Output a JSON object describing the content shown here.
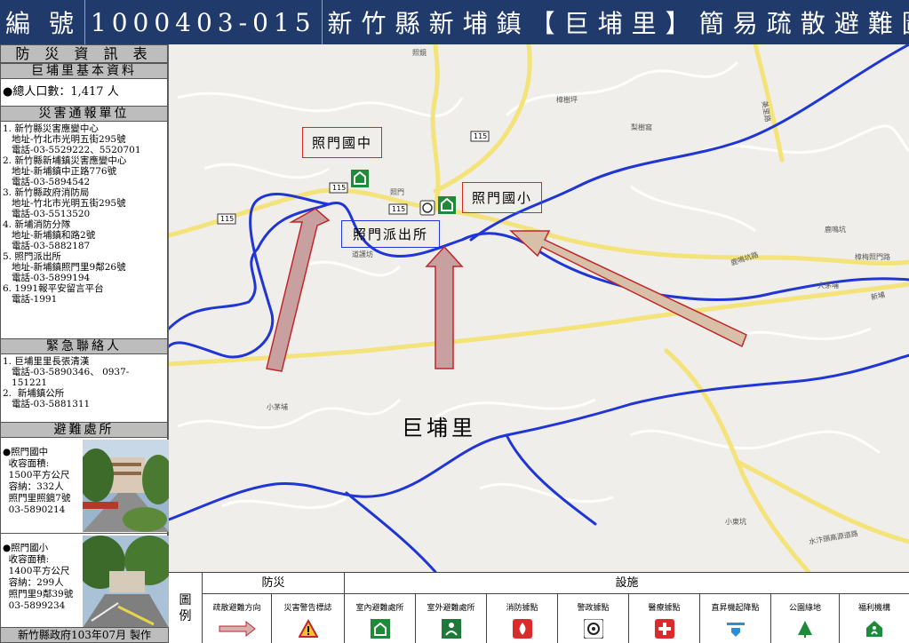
{
  "title": {
    "prefix": "編 號",
    "code": "1000403-015",
    "name": [
      "新",
      "竹",
      "縣",
      "新",
      "埔",
      "鎮",
      "【",
      "巨",
      "埔",
      "里",
      "】",
      "簡",
      "易",
      "疏",
      "散",
      "避",
      "難",
      "圖"
    ]
  },
  "sidebar": {
    "info_header": "防 災 資 訊 表",
    "basic_header": "巨埔里基本資料",
    "population": "●總人口數：1,417 人",
    "agency_header": "災害通報單位",
    "agencies": [
      "1. 新竹縣災害應變中心",
      "   地址-竹北市光明五街295號",
      "   電話-03-5529222、5520701",
      "2. 新竹縣新埔鎮災害應變中心",
      "   地址-新埔鎮中正路776號",
      "   電話-03-5894542",
      "3. 新竹縣政府消防局",
      "   地址-竹北市光明五街295號",
      "   電話-03-5513520",
      "4. 新埔消防分隊",
      "   地址-新埔鎮和路2號",
      "   電話-03-5882187",
      "5. 照門派出所",
      "   地址-新埔鎮照門里9鄰26號",
      "   電話-03-5899194",
      "6. 1991報平安留言平台",
      "   電話-1991"
    ],
    "contact_header": "緊急聯絡人",
    "contacts": [
      "1. 巨埔里里長張清漢",
      "   電話-03-5890346、 0937-",
      "   151221",
      "2.  新埔鎮公所",
      "   電話-03-5881311"
    ],
    "shelter_header": "避難處所",
    "shelters": [
      {
        "lines": [
          "●照門國中",
          "  收容面積:",
          "  1500平方公尺",
          "  容納：332人",
          "  照門里照鏡7號",
          "  03-5890214"
        ]
      },
      {
        "lines": [
          "●照門國小",
          "  收容面積:",
          "  1400平方公尺",
          "  容納：299人",
          "  照門里9鄰39號",
          "  03-5899234"
        ]
      }
    ],
    "footer": "新竹縣政府103年07月 製作"
  },
  "map": {
    "labels": {
      "school_jh": "照門國中",
      "school_es": "照門國小",
      "police": "照門派出所",
      "village": "巨埔里",
      "road115a": "115",
      "road115b": "115",
      "road115c": "115",
      "road115d": "115",
      "zhaomen": "照門",
      "zhaojing": "照鏡",
      "zhangshuping": "樟樹坪",
      "lishuwo": "梨樹窩",
      "lumingkeng": "鹿鳴坑",
      "daohusi": "道護坊",
      "damaopu": "大茅埔",
      "xiaomaopu": "小茅埔",
      "xiaodongkeng": "小東坑",
      "xinpu": "新埔",
      "zhangmei": "樟梅照門路",
      "lumingkeng_road": "鹿鳴坑路",
      "shuige": "水汴頭高源道路",
      "top_right": "美里路"
    }
  },
  "legend": {
    "label": [
      "圖",
      "例"
    ],
    "group_disaster": "防災",
    "group_facility": "設施",
    "items": [
      {
        "label": "疏散避難方向",
        "icon": "evacuation-arrow-icon"
      },
      {
        "label": "災害警告標誌",
        "icon": "warning-triangle-icon"
      },
      {
        "label": "室內避難處所",
        "icon": "indoor-shelter-icon"
      },
      {
        "label": "室外避難處所",
        "icon": "outdoor-shelter-icon"
      },
      {
        "label": "消防據點",
        "icon": "fire-station-icon"
      },
      {
        "label": "警政據點",
        "icon": "police-icon"
      },
      {
        "label": "醫療據點",
        "icon": "medical-icon"
      },
      {
        "label": "直昇機起降點",
        "icon": "helipad-icon"
      },
      {
        "label": "公園綠地",
        "icon": "park-icon"
      },
      {
        "label": "福利機構",
        "icon": "welfare-icon"
      }
    ]
  }
}
